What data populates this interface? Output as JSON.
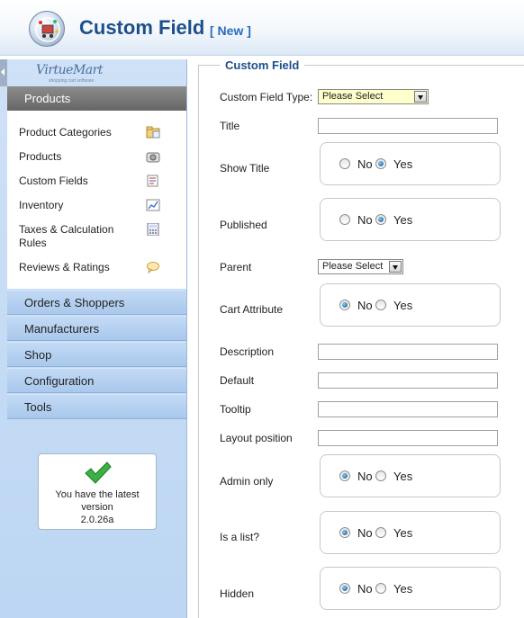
{
  "header": {
    "title": "Custom Field",
    "subtitle": "[ New ]"
  },
  "sidebar": {
    "brand": "VirtueMart",
    "brand_tagline": "shopping cart software",
    "active_section": "Products",
    "submenu": [
      {
        "label": "Product Categories",
        "icon": "folder-icon"
      },
      {
        "label": "Products",
        "icon": "camera-icon"
      },
      {
        "label": "Custom Fields",
        "icon": "fields-icon"
      },
      {
        "label": "Inventory",
        "icon": "chart-icon"
      },
      {
        "label": "Taxes & Calculation Rules",
        "icon": "calculator-icon"
      },
      {
        "label": "Reviews & Ratings",
        "icon": "speech-bubble-icon"
      }
    ],
    "sections": [
      "Orders & Shoppers",
      "Manufacturers",
      "Shop",
      "Configuration",
      "Tools"
    ],
    "version_box": {
      "message": "You have the latest version",
      "version": "2.0.26a"
    }
  },
  "form": {
    "legend": "Custom Field",
    "field_type": {
      "label": "Custom Field Type:",
      "value": "Please Select"
    },
    "title": {
      "label": "Title",
      "value": ""
    },
    "show_title": {
      "label": "Show Title",
      "selected": "Yes"
    },
    "published": {
      "label": "Published",
      "selected": "Yes"
    },
    "parent": {
      "label": "Parent",
      "value": "Please Select"
    },
    "cart_attribute": {
      "label": "Cart Attribute",
      "selected": "No"
    },
    "description": {
      "label": "Description",
      "value": ""
    },
    "default": {
      "label": "Default",
      "value": ""
    },
    "tooltip": {
      "label": "Tooltip",
      "value": ""
    },
    "layout_position": {
      "label": "Layout position",
      "value": ""
    },
    "admin_only": {
      "label": "Admin only",
      "selected": "No"
    },
    "is_list": {
      "label": "Is a list?",
      "selected": "No"
    },
    "hidden": {
      "label": "Hidden",
      "selected": "No"
    },
    "option_no": "No",
    "option_yes": "Yes"
  },
  "colors": {
    "title": "#1d4f8a",
    "sidebar_section": "#b9d3f1",
    "active_section": "#777777",
    "field_type_bg": "#ffffcc"
  }
}
